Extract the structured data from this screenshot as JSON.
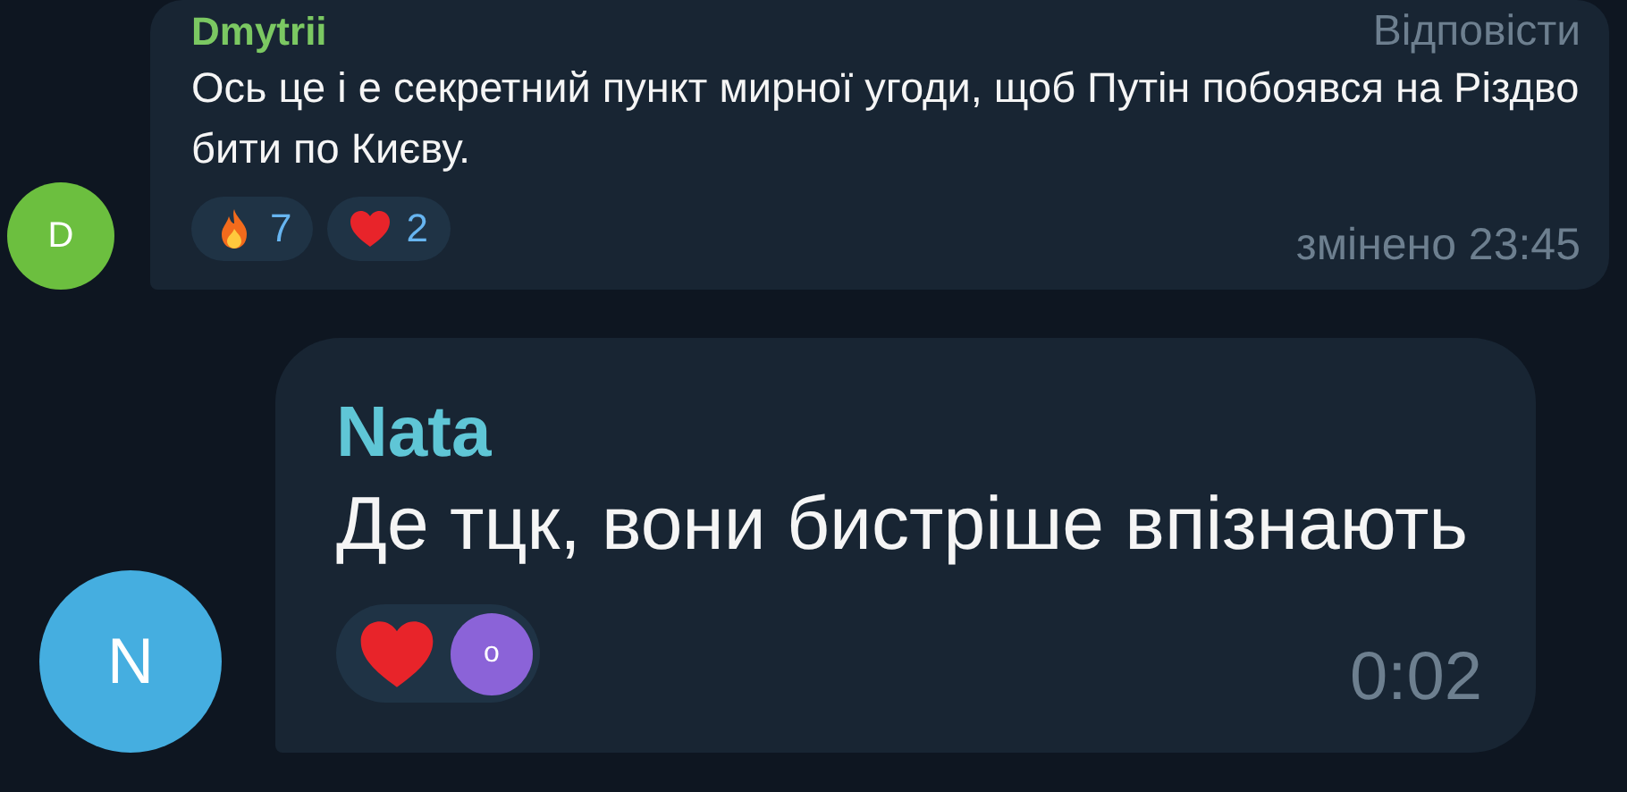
{
  "messages": [
    {
      "author": {
        "name": "Dmytrii",
        "color": "#7bc862"
      },
      "avatar": {
        "letter": "D",
        "color": "#6cbf3f"
      },
      "reply": "Відповісти",
      "text": "Ось це і е секретний пункт мирної угоди, щоб Путін побоявся на Різдво бити по Києву.",
      "reactions": [
        {
          "kind": "fire",
          "count": "7"
        },
        {
          "kind": "heart",
          "count": "2"
        }
      ],
      "time": "змінено 23:45"
    },
    {
      "author": {
        "name": "Nata",
        "color": "#5fc6d6"
      },
      "avatar": {
        "letter": "N",
        "color": "#45aee0"
      },
      "text": "Де тцк, вони бистріше впізнають",
      "reactions": [
        {
          "kind": "heart",
          "reactor": "o"
        }
      ],
      "time": "0:02"
    }
  ]
}
